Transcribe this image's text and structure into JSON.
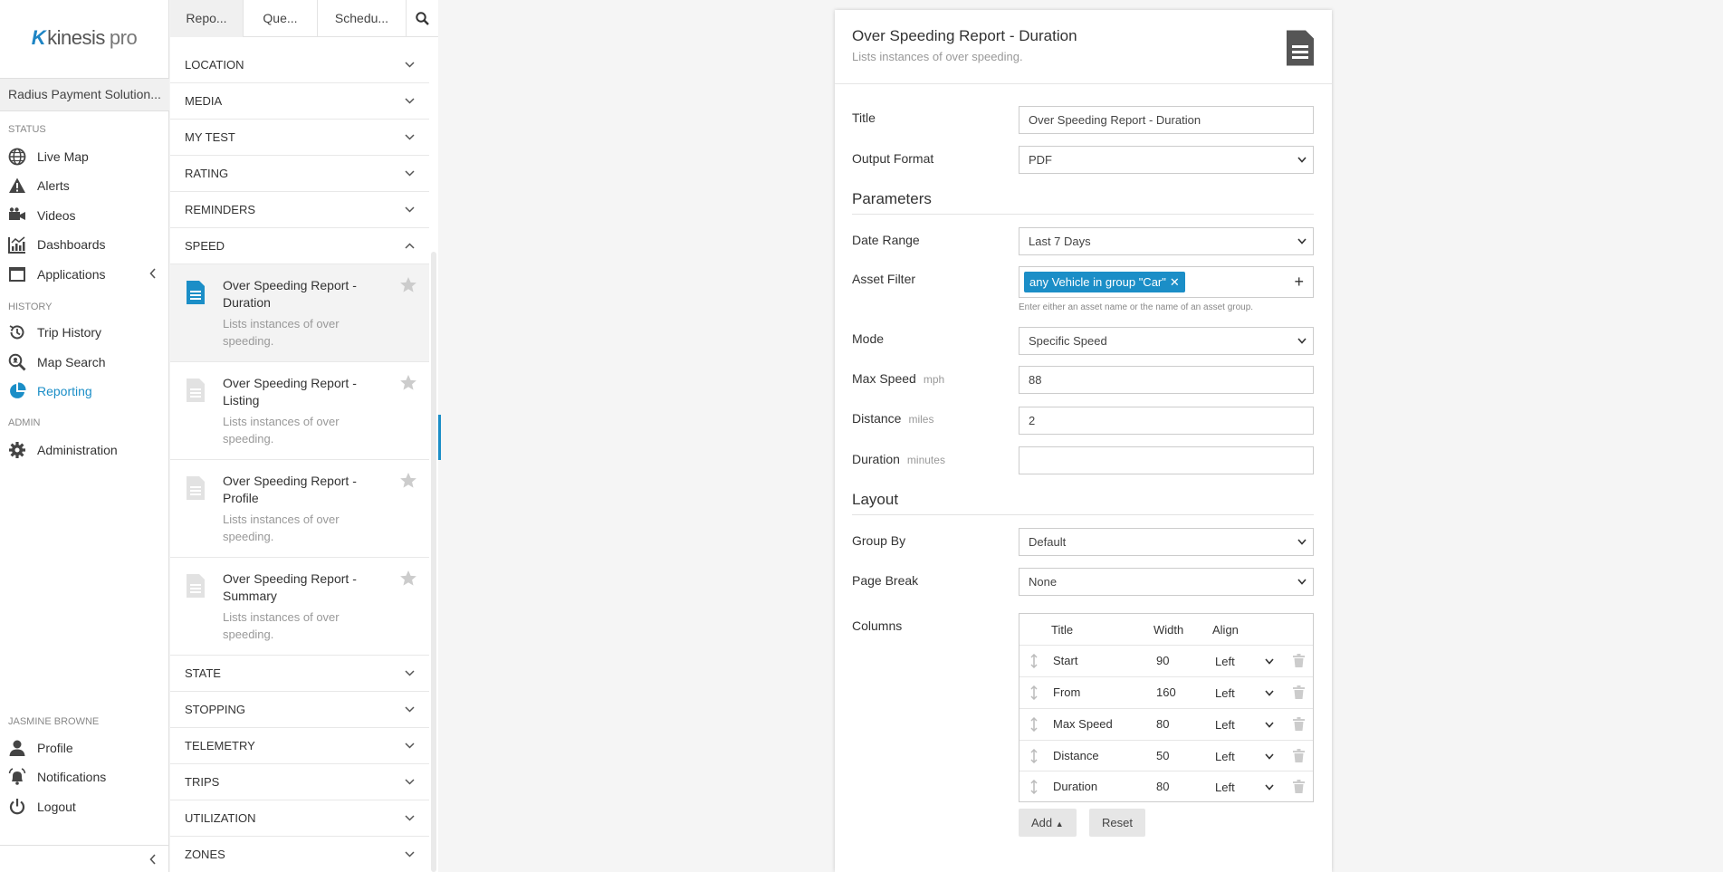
{
  "app": {
    "brand_k": "K",
    "brand_name": "kinesis",
    "brand_suffix": "pro",
    "account": "Radius Payment Solution..."
  },
  "nav": {
    "status_label": "STATUS",
    "history_label": "HISTORY",
    "admin_label": "ADMIN",
    "user_label": "JASMINE BROWNE",
    "live_map": "Live Map",
    "alerts": "Alerts",
    "videos": "Videos",
    "dashboards": "Dashboards",
    "applications": "Applications",
    "trip_history": "Trip History",
    "map_search": "Map Search",
    "reporting": "Reporting",
    "administration": "Administration",
    "profile": "Profile",
    "notifications": "Notifications",
    "logout": "Logout",
    "accent": "#1b8ec7"
  },
  "list": {
    "tabs": [
      "Repo...",
      "Que...",
      "Schedu..."
    ],
    "groups_top": [
      "LOCATION",
      "MEDIA",
      "MY TEST",
      "RATING",
      "REMINDERS",
      "SPEED"
    ],
    "reports": [
      {
        "title": "Over Speeding Report - Duration",
        "desc": "Lists instances of over speeding."
      },
      {
        "title": "Over Speeding Report - Listing",
        "desc": "Lists instances of over speeding."
      },
      {
        "title": "Over Speeding Report - Profile",
        "desc": "Lists instances of over speeding."
      },
      {
        "title": "Over Speeding Report - Summary",
        "desc": "Lists instances of over speeding."
      }
    ],
    "groups_bottom": [
      "STATE",
      "STOPPING",
      "TELEMETRY",
      "TRIPS",
      "UTILIZATION",
      "ZONES"
    ]
  },
  "form": {
    "title": "Over Speeding Report - Duration",
    "subtitle": "Lists instances of over speeding.",
    "title_label": "Title",
    "title_value": "Over Speeding Report - Duration",
    "output_label": "Output Format",
    "output_value": "PDF",
    "parameters_heading": "Parameters",
    "date_range_label": "Date Range",
    "date_range_value": "Last 7 Days",
    "asset_filter_label": "Asset Filter",
    "asset_chip": "any Vehicle in group \"Car\"",
    "asset_hint": "Enter either an asset name or the name of an asset group.",
    "mode_label": "Mode",
    "mode_value": "Specific Speed",
    "max_speed_label": "Max Speed",
    "max_speed_unit": "mph",
    "max_speed_value": "88",
    "distance_label": "Distance",
    "distance_unit": "miles",
    "distance_value": "2",
    "duration_label": "Duration",
    "duration_unit": "minutes",
    "duration_value": "",
    "layout_heading": "Layout",
    "group_by_label": "Group By",
    "group_by_value": "Default",
    "page_break_label": "Page Break",
    "page_break_value": "None",
    "columns_label": "Columns",
    "col_headers": {
      "title": "Title",
      "width": "Width",
      "align": "Align"
    },
    "columns": [
      {
        "title": "Start",
        "width": "90",
        "align": "Left"
      },
      {
        "title": "From",
        "width": "160",
        "align": "Left"
      },
      {
        "title": "Max Speed",
        "width": "80",
        "align": "Left"
      },
      {
        "title": "Distance",
        "width": "50",
        "align": "Left"
      },
      {
        "title": "Duration",
        "width": "80",
        "align": "Left"
      }
    ],
    "add_label": "Add",
    "reset_label": "Reset"
  }
}
